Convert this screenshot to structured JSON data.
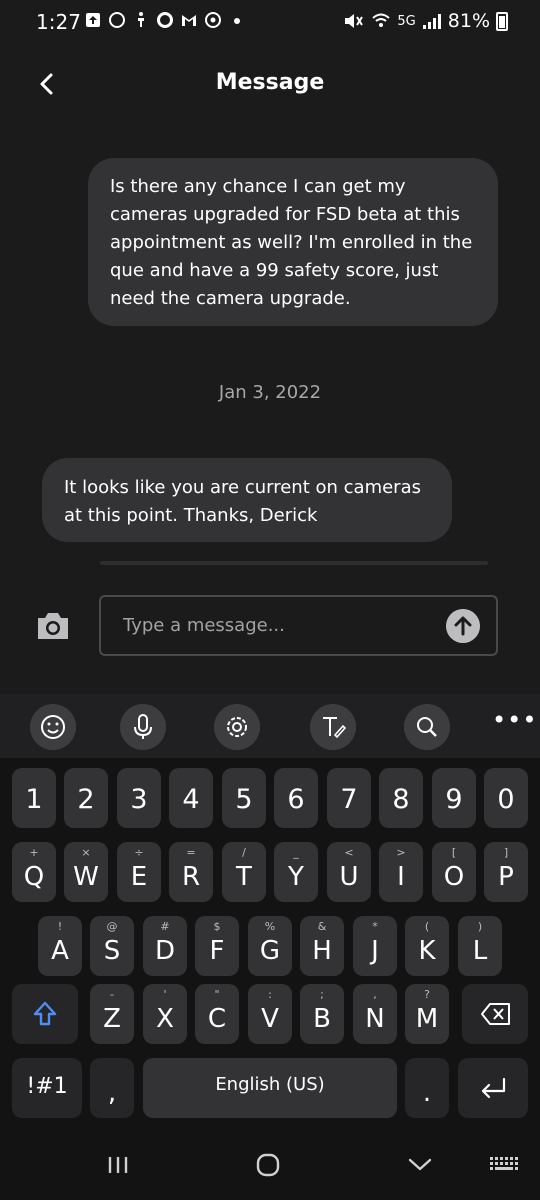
{
  "status_bar": {
    "time": "1:27",
    "network": "5G",
    "battery": "81%",
    "left_icons": [
      "upload-icon",
      "circle-icon",
      "accessibility-icon",
      "o-icon",
      "gmail-icon",
      "app-icon",
      "dot-icon"
    ],
    "right_icons": [
      "mute-icon",
      "wifi-icon",
      "signal-icon",
      "battery-icon"
    ]
  },
  "header": {
    "title": "Message"
  },
  "messages": {
    "outgoing": [
      {
        "lines": [
          "Is there any chance I can get my",
          "cameras upgraded for FSD beta at this",
          "appointment as well? I'm enrolled in the",
          "que and have a 99 safety score, just",
          "need the camera upgrade."
        ]
      }
    ],
    "date_separator": "Jan 3, 2022",
    "incoming": [
      {
        "lines": [
          "It looks like you are current on cameras",
          "at this point. Thanks, Derick"
        ]
      }
    ]
  },
  "composer": {
    "placeholder": "Type a message..."
  },
  "keyboard": {
    "toolbar_icons": [
      "emoji-icon",
      "microphone-icon",
      "settings-icon",
      "handwriting-icon",
      "search-icon",
      "more-icon"
    ],
    "more_label": "•••",
    "number_row": [
      "1",
      "2",
      "3",
      "4",
      "5",
      "6",
      "7",
      "8",
      "9",
      "0"
    ],
    "row1": [
      {
        "k": "Q",
        "h": "+"
      },
      {
        "k": "W",
        "h": "×"
      },
      {
        "k": "E",
        "h": "÷"
      },
      {
        "k": "R",
        "h": "="
      },
      {
        "k": "T",
        "h": "/"
      },
      {
        "k": "Y",
        "h": "_"
      },
      {
        "k": "U",
        "h": "<"
      },
      {
        "k": "I",
        "h": ">"
      },
      {
        "k": "O",
        "h": "["
      },
      {
        "k": "P",
        "h": "]"
      }
    ],
    "row2": [
      {
        "k": "A",
        "h": "!"
      },
      {
        "k": "S",
        "h": "@"
      },
      {
        "k": "D",
        "h": "#"
      },
      {
        "k": "F",
        "h": "$"
      },
      {
        "k": "G",
        "h": "%"
      },
      {
        "k": "H",
        "h": "&"
      },
      {
        "k": "J",
        "h": "*"
      },
      {
        "k": "K",
        "h": "("
      },
      {
        "k": "L",
        "h": ")"
      }
    ],
    "row3": [
      {
        "k": "Z",
        "h": "-"
      },
      {
        "k": "X",
        "h": "'"
      },
      {
        "k": "C",
        "h": "\""
      },
      {
        "k": "V",
        "h": ":"
      },
      {
        "k": "B",
        "h": ";"
      },
      {
        "k": "N",
        "h": ","
      },
      {
        "k": "M",
        "h": "?"
      }
    ],
    "symbols_label": "!#1",
    "comma_label": ",",
    "space_label": "English (US)",
    "period_label": ".",
    "shift_icon": "shift-icon",
    "backspace_icon": "backspace-icon",
    "enter_icon": "enter-icon",
    "colors": {
      "shift_accent": "#4f8ef7"
    }
  },
  "nav_bar": {
    "icons": [
      "recent-apps-icon",
      "home-icon",
      "back-icon",
      "keyboard-switch-icon"
    ]
  }
}
